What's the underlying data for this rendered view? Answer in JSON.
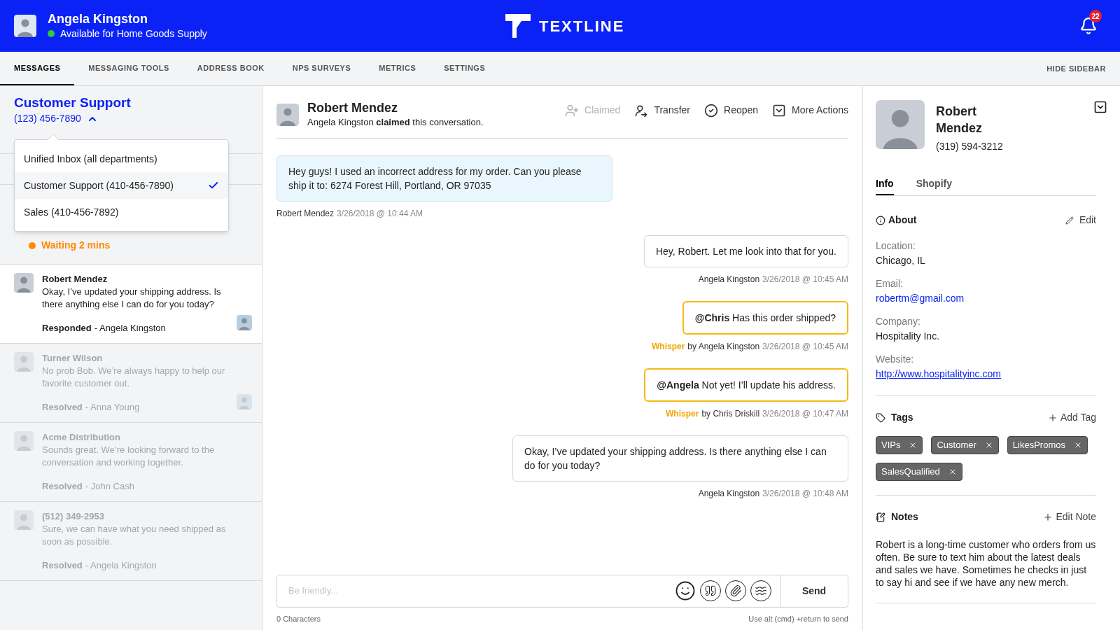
{
  "header": {
    "user": {
      "name": "Angela Kingston",
      "status": "Available for Home Goods Supply",
      "online": true
    },
    "logo": "TEXTLINE",
    "notifications": "22"
  },
  "nav": {
    "tabs": [
      {
        "label": "MESSAGES",
        "selected": true
      },
      {
        "label": "MESSAGING TOOLS",
        "selected": false
      },
      {
        "label": "ADDRESS BOOK",
        "selected": false
      },
      {
        "label": "NPS SURVEYS",
        "selected": false
      },
      {
        "label": "METRICS",
        "selected": false
      },
      {
        "label": "SETTINGS",
        "selected": false
      }
    ],
    "hide_sidebar": "HIDE SIDEBAR"
  },
  "inbox": {
    "department": "Customer Support",
    "phone": "(123) 456-7890",
    "expanded": true,
    "dropdown": [
      {
        "label": "Unified Inbox (all departments)",
        "selected": false
      },
      {
        "label": "Customer Support (410-456-7890)",
        "selected": true
      },
      {
        "label": "Sales (410-456-7892)",
        "selected": false
      }
    ],
    "conversations": [
      {
        "kind": "waiting",
        "status": "Waiting 2 mins"
      },
      {
        "kind": "message",
        "name": "Robert Mendez",
        "preview": "Okay, I’ve updated your shipping address. Is there anything else I can do for you today?",
        "status": "Responded",
        "agent": "- Angela Kingston",
        "selected": true,
        "faded": false,
        "agent_avatar": true
      },
      {
        "kind": "message",
        "name": "Turner Wilson",
        "preview": "No prob Bob. We’re always happy to help our favorite customer out.",
        "status": "Resolved",
        "agent": "- Anna Young",
        "selected": false,
        "faded": true,
        "agent_avatar": true
      },
      {
        "kind": "message",
        "name": "Acme Distribution",
        "preview": "Sounds great. We’re looking forward to the conversation and working together.",
        "status": "Resolved",
        "agent": "- John Cash",
        "selected": false,
        "faded": true,
        "agent_avatar": false
      },
      {
        "kind": "message",
        "name": "(512) 349-2953",
        "preview": "Sure, we can have what you need shipped as soon as possible.",
        "status": "Resolved",
        "agent": "- Angela Kingston",
        "selected": false,
        "faded": true,
        "agent_avatar": false
      }
    ]
  },
  "conversation": {
    "name": "Robert Mendez",
    "claim": "Angela Kingston **claimed** this conversation.",
    "actions": [
      {
        "kind": "claim",
        "label": "Claimed",
        "disabled": true
      },
      {
        "kind": "transfer",
        "label": "Transfer",
        "disabled": false
      },
      {
        "kind": "reopen",
        "label": "Reopen",
        "disabled": false
      },
      {
        "kind": "more",
        "label": "More Actions",
        "disabled": false
      }
    ],
    "messages": [
      {
        "kind": "inbound",
        "text": "Hey guys! I used an incorrect address for my order. Can you please ship it to: 6274 Forest Hill, Portland, OR 97035",
        "author": "Robert Mendez",
        "time": "3/26/2018 @ 10:44 AM"
      },
      {
        "kind": "outbound",
        "text": "Hey, Robert. Let me look into that for you.",
        "author": "Angela Kingston",
        "time": "3/26/2018 @ 10:45 AM"
      },
      {
        "kind": "whisper",
        "text": "**@Chris** Has this order shipped?",
        "label": "Whisper",
        "author": "by Angela Kingston",
        "time": "3/26/2018 @ 10:45 AM"
      },
      {
        "kind": "whisper",
        "text": "**@Angela** Not yet! I’ll update his address.",
        "label": "Whisper",
        "author": "by Chris Driskill",
        "time": "3/26/2018 @ 10:47 AM"
      },
      {
        "kind": "outbound",
        "text": "Okay, I’ve updated your shipping address. Is there anything else I can do for you today?",
        "author": "Angela Kingston",
        "time": "3/26/2018 @ 10:48 AM"
      }
    ],
    "composer": {
      "placeholder": "Be friendly...",
      "send": "Send",
      "count": "0 Characters",
      "hint": "Use alt (cmd) +return to send"
    }
  },
  "contact": {
    "name": "Robert Mendez",
    "phone": "(319) 594-3212",
    "tabs": [
      {
        "label": "Info",
        "selected": true
      },
      {
        "label": "Shopify",
        "selected": false
      }
    ],
    "about": {
      "title": "About",
      "edit": "Edit",
      "fields": [
        {
          "kind": "text",
          "label": "Location:",
          "value": "Chicago, IL"
        },
        {
          "kind": "email",
          "label": "Email:",
          "value": "robertm@gmail.com"
        },
        {
          "kind": "text",
          "label": "Company:",
          "value": "Hospitality Inc."
        },
        {
          "kind": "link",
          "label": "Website:",
          "value": "http://www.hospitalityinc.com"
        }
      ]
    },
    "tags": {
      "title": "Tags",
      "add": "Add Tag",
      "items": [
        "VIPs",
        "Customer",
        "LikesPromos",
        "SalesQualified"
      ]
    },
    "notes": {
      "title": "Notes",
      "edit": "Edit Note",
      "text": "Robert is a long-time customer who orders from us often. Be sure to text him about the latest deals and sales we have. Sometimes he checks in just to say hi and see if we have any new merch."
    }
  }
}
